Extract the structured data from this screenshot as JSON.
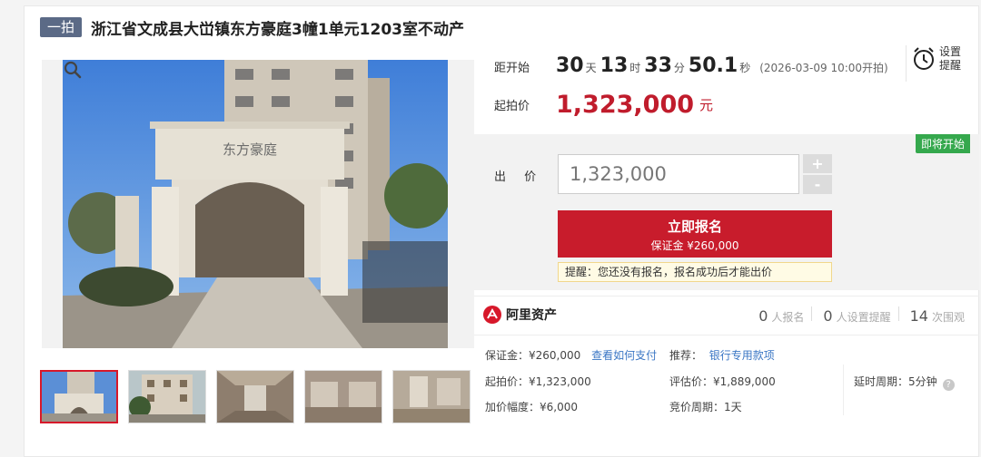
{
  "header": {
    "badge": "一拍",
    "title": "浙江省文成县大峃镇东方豪庭3幢1单元1203室不动产"
  },
  "countdown": {
    "label": "距开始",
    "days": "30",
    "days_unit": "天",
    "hours": "13",
    "hours_unit": "时",
    "minutes": "33",
    "minutes_unit": "分",
    "seconds": "50.1",
    "seconds_unit": "秒",
    "start_note": "(2026-03-09 10:00开拍)"
  },
  "remind": {
    "label_1": "设置",
    "label_2": "提醒",
    "icon": "alarm-clock-icon"
  },
  "price": {
    "label": "起拍价",
    "value": "1,323,000",
    "unit": "元"
  },
  "bid": {
    "status_badge": "即将开始",
    "label": "出 价",
    "value": "1,323,000",
    "plus": "+",
    "minus": "-",
    "signup_title": "立即报名",
    "signup_deposit": "保证金 ¥260,000",
    "tip": "提醒：您还没有报名，报名成功后才能出价"
  },
  "stats": {
    "brand": "阿里资产",
    "signups": "0",
    "signups_label": "人报名",
    "reminders": "0",
    "reminders_label": "人设置提醒",
    "views": "14",
    "views_label": "次围观"
  },
  "details": {
    "deposit_label": "保证金：¥260,000",
    "pay_link": "查看如何支付",
    "recommend_label": "推荐：",
    "bank_link": "银行专用款项",
    "start_price": "起拍价：¥1,323,000",
    "appraisal": "评估价：¥1,889,000",
    "delay": "延时周期：5分钟",
    "increment": "加价幅度：¥6,000",
    "cycle": "竞价周期：1天"
  },
  "colors": {
    "accent": "#c81c2c",
    "badge": "#5b6a86",
    "status": "#35a84d",
    "link": "#3a76c4"
  },
  "main_image": {
    "sign_text": "东方豪庭"
  }
}
